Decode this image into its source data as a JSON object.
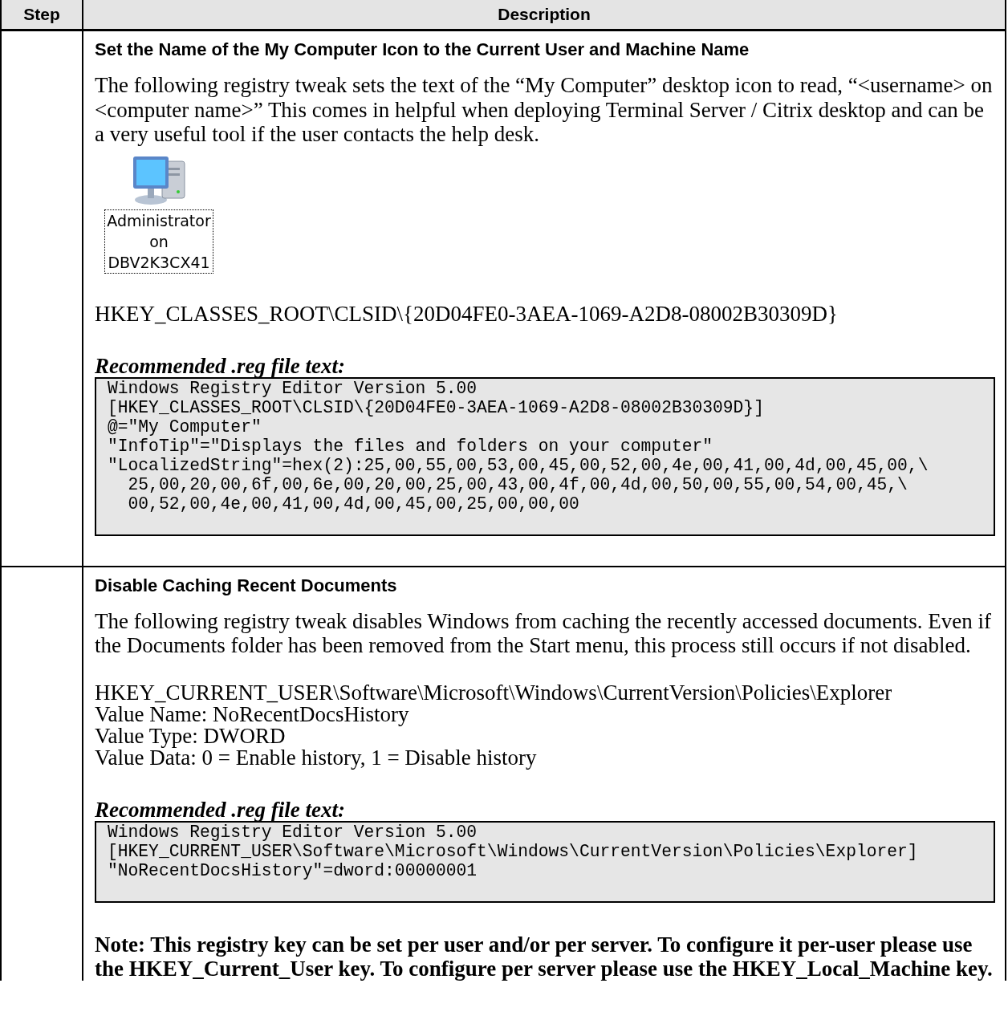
{
  "table": {
    "columns": [
      "Step",
      "Description"
    ],
    "rows": [
      {
        "blocks": [
          {
            "kind": "heading",
            "text": "Set the Name of the My Computer Icon to the Current User and Machine Name"
          },
          {
            "kind": "paragraph",
            "text": "The following registry tweak sets the text of the “My Computer” desktop icon to read, “<username> on <computer name>” This comes in helpful when deploying Terminal Server / Citrix desktop and can be a very useful tool if the user contacts the help desk."
          },
          {
            "kind": "desktop_icon",
            "label_lines": [
              "Administrator",
              "on",
              "DBV2K3CX41"
            ]
          },
          {
            "kind": "text_lines",
            "lines": [
              "HKEY_CLASSES_ROOT\\CLSID\\{20D04FE0-3AEA-1069-A2D8-08002B30309D}"
            ]
          },
          {
            "kind": "caption",
            "text": "Recommended .reg file text:"
          },
          {
            "kind": "code",
            "lines": [
              "Windows Registry Editor Version 5.00",
              "[HKEY_CLASSES_ROOT\\CLSID\\{20D04FE0-3AEA-1069-A2D8-08002B30309D}]",
              "@=\"My Computer\"",
              "\"InfoTip\"=\"Displays the files and folders on your computer\"",
              "\"LocalizedString\"=hex(2):25,00,55,00,53,00,45,00,52,00,4e,00,41,00,4d,00,45,00,\\",
              "  25,00,20,00,6f,00,6e,00,20,00,25,00,43,00,4f,00,4d,00,50,00,55,00,54,00,45,\\",
              "  00,52,00,4e,00,41,00,4d,00,45,00,25,00,00,00"
            ]
          }
        ]
      },
      {
        "blocks": [
          {
            "kind": "heading",
            "text": "Disable Caching Recent Documents"
          },
          {
            "kind": "paragraph",
            "text": "The following registry tweak disables Windows from caching the recently accessed documents.  Even if the Documents folder has been removed from the Start menu, this process still occurs if not disabled."
          },
          {
            "kind": "text_lines",
            "lines": [
              "HKEY_CURRENT_USER\\Software\\Microsoft\\Windows\\CurrentVersion\\Policies\\Explorer",
              "Value Name: NoRecentDocsHistory",
              "Value Type: DWORD",
              "Value Data: 0 = Enable history, 1 = Disable history"
            ]
          },
          {
            "kind": "caption",
            "text": "Recommended .reg file text:"
          },
          {
            "kind": "code",
            "lines": [
              "Windows Registry Editor Version 5.00",
              "[HKEY_CURRENT_USER\\Software\\Microsoft\\Windows\\CurrentVersion\\Policies\\Explorer]",
              "\"NoRecentDocsHistory\"=dword:00000001"
            ]
          },
          {
            "kind": "note",
            "text": "Note: This registry key can be set per user and/or per server.  To configure it per-user please use the HKEY_Current_User key.  To configure per server please use the HKEY_Local_Machine key."
          }
        ]
      }
    ]
  }
}
